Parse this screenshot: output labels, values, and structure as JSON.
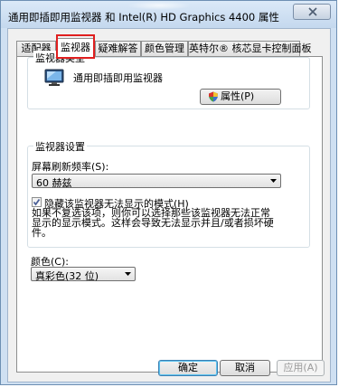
{
  "window": {
    "title": "通用即插即用监视器 和 Intel(R) HD Graphics 4400 属性"
  },
  "tabs": [
    {
      "label": "适配器"
    },
    {
      "label": "监视器"
    },
    {
      "label": "疑难解答"
    },
    {
      "label": "颜色管理"
    },
    {
      "label": "英特尔® 核芯显卡控制面板"
    }
  ],
  "monitor_type": {
    "legend": "监视器类型",
    "name": "通用即插即用监视器",
    "properties_button": "属性(P)"
  },
  "monitor_settings": {
    "legend": "监视器设置",
    "refresh_label": "屏幕刷新频率(S):",
    "refresh_value": "60 赫兹",
    "hide_modes_checkbox_label": "隐藏该监视器无法显示的模式(H)",
    "hide_modes_checked": true,
    "description": "如果不复选该项，则你可以选择那些该监视器无法正常显示的显示模式。这样会导致无法显示并且/或者损坏硬件。"
  },
  "colors": {
    "label": "颜色(C):",
    "value": "真彩色(32 位)"
  },
  "buttons": {
    "ok": "确定",
    "cancel": "取消",
    "apply": "应用(A)"
  },
  "accent_colors": {
    "highlight": "#e01f1f",
    "frame": "#cfe0f2"
  }
}
